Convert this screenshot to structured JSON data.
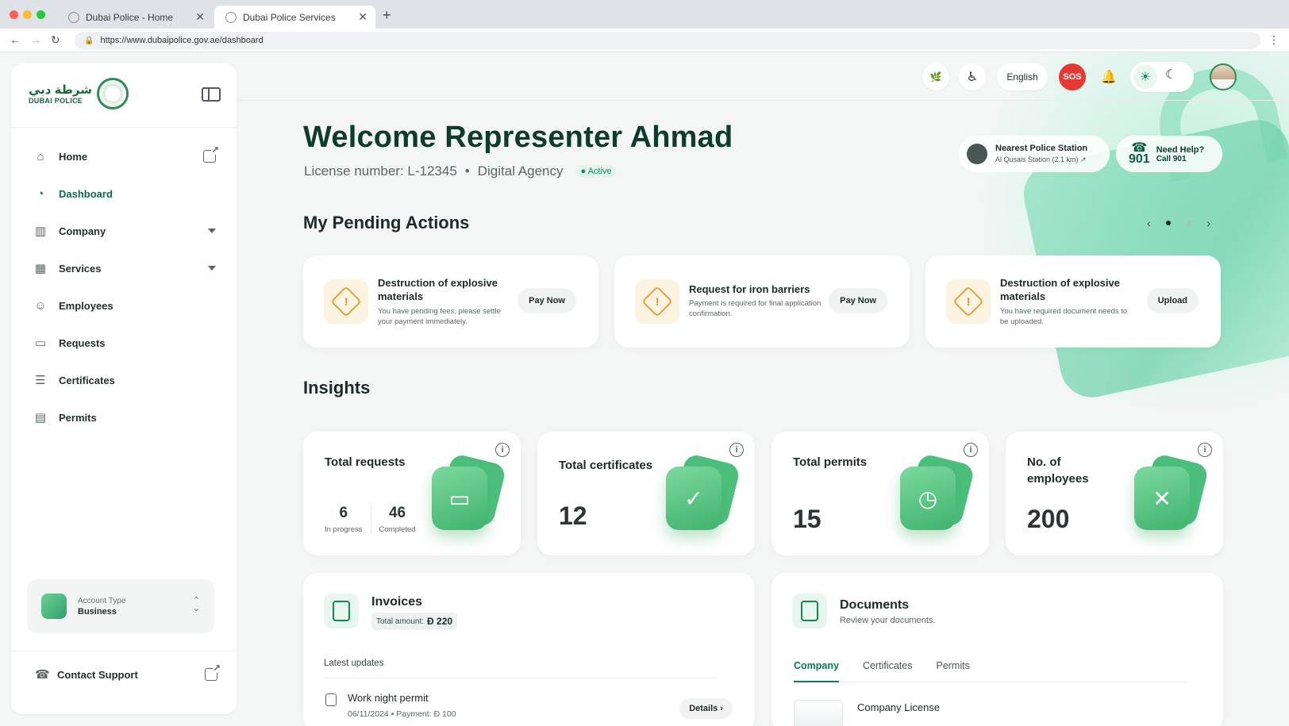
{
  "browser": {
    "tabs": [
      {
        "label": "Dubai Police - Home"
      },
      {
        "label": "Dubai Police Services"
      }
    ],
    "url": "https://www.dubaipolice.gov.ae/dashboard"
  },
  "sidebar": {
    "logo": {
      "arabic": "شرطة دبي",
      "english": "DUBAI POLICE"
    },
    "items": [
      {
        "label": "Home",
        "icon": "home-icon"
      },
      {
        "label": "Dashboard",
        "icon": "dashboard-icon"
      },
      {
        "label": "Company",
        "icon": "building-icon"
      },
      {
        "label": "Services",
        "icon": "grid-icon"
      },
      {
        "label": "Employees",
        "icon": "users-icon"
      },
      {
        "label": "Requests",
        "icon": "folder-icon"
      },
      {
        "label": "Certificates",
        "icon": "certificate-icon"
      },
      {
        "label": "Permits",
        "icon": "document-icon"
      }
    ],
    "account": {
      "type_label": "Account Type",
      "type_value": "Business"
    },
    "support_label": "Contact Support",
    "support_icon_text": "901"
  },
  "header": {
    "language": "English",
    "sos": "SOS"
  },
  "welcome": {
    "title": "Welcome Representer Ahmad",
    "license": "License number: L-12345",
    "agency": "Digital Agency",
    "status": "Active",
    "station_title": "Nearest Police Station",
    "station_sub": "Al Qusais Station (2.1 km)",
    "help_number": "901",
    "help_title": "Need Help?",
    "help_sub": "Call 901"
  },
  "pending": {
    "title": "My Pending Actions",
    "cards": [
      {
        "title": "Destruction of explosive materials",
        "desc": "You have pending fees, please settle your payment immediately.",
        "action": "Pay Now"
      },
      {
        "title": "Request for iron barriers",
        "desc": "Payment is required for final application confirmation.",
        "action": "Pay Now"
      },
      {
        "title": "Destruction of explosive materials",
        "desc": "You have required document needs to be uploaded.",
        "action": "Upload"
      }
    ]
  },
  "insights": {
    "title": "Insights",
    "cards": [
      {
        "title": "Total requests",
        "in_progress": "6",
        "in_progress_label": "In progress",
        "completed": "46",
        "completed_label": "Completed"
      },
      {
        "title": "Total certificates",
        "value": "12"
      },
      {
        "title": "Total permits",
        "value": "15"
      },
      {
        "title": "No. of employees",
        "value": "200"
      }
    ]
  },
  "invoices": {
    "title": "Invoices",
    "total_label": "Total amount:",
    "total_value": "Ð 220",
    "latest_label": "Latest updates",
    "row_title": "Work night permit",
    "row_sub": "06/11/2024 • Payment: Ð 100",
    "details_label": "Details"
  },
  "documents": {
    "title": "Documents",
    "subtitle": "Review your documents.",
    "tabs": [
      "Company",
      "Certificates",
      "Permits"
    ],
    "item": "Company License"
  },
  "colors": {
    "brand": "#0e7a52",
    "sos": "#e53935",
    "warning": "#e3a33b"
  }
}
